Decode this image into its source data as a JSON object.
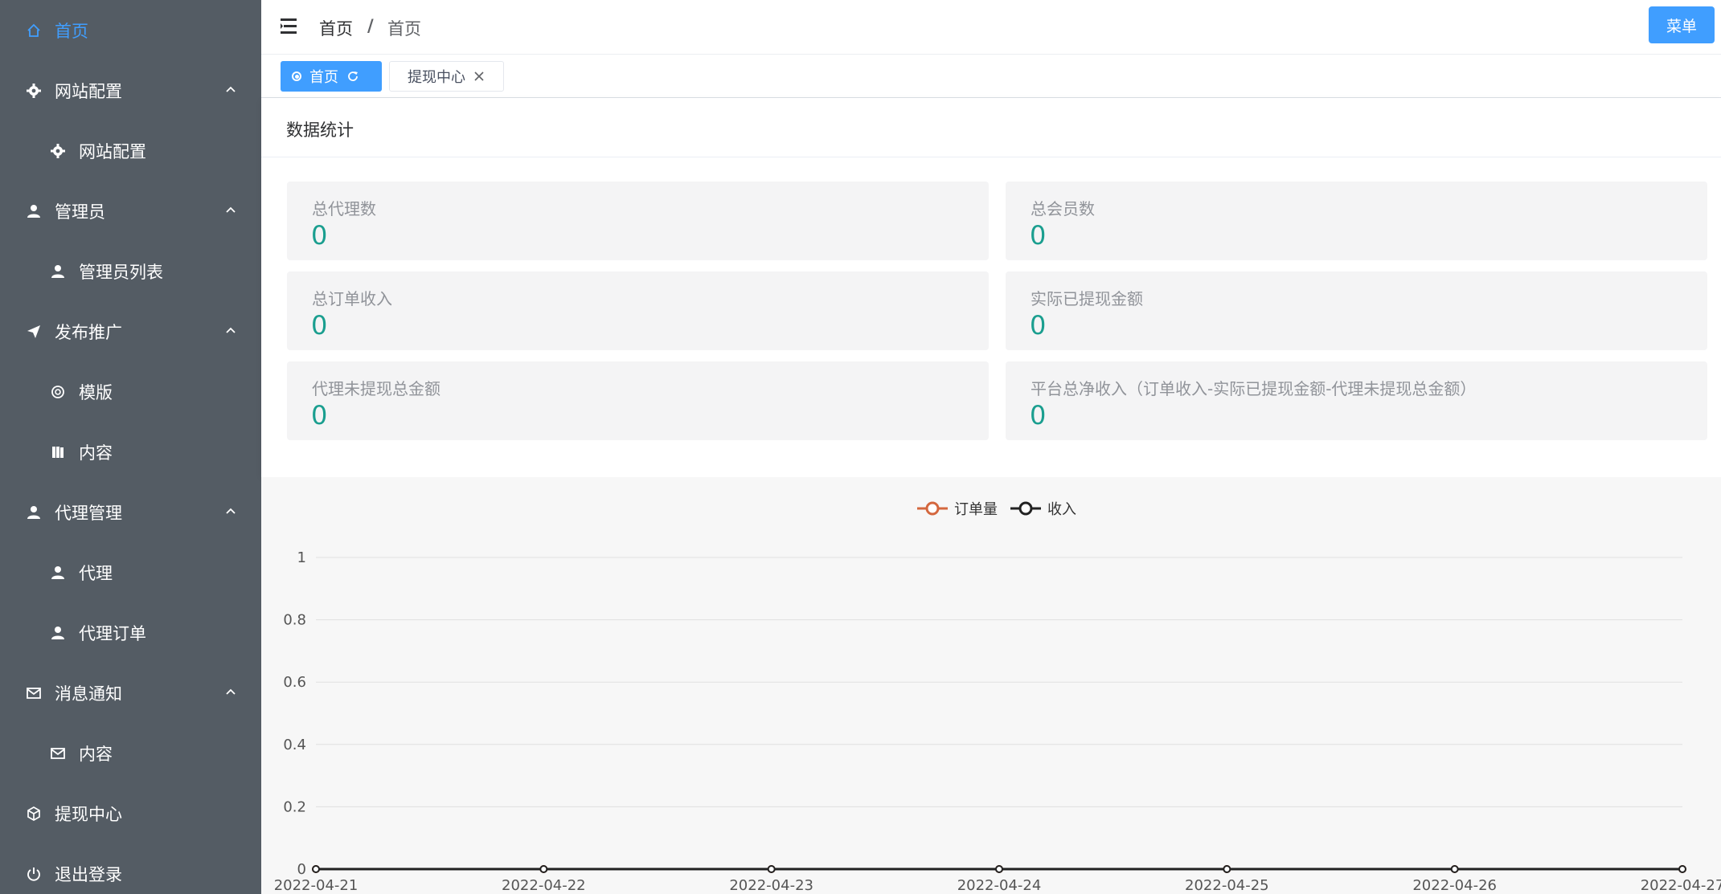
{
  "sidebar": {
    "items": [
      {
        "label": "首页",
        "icon": "home-icon",
        "level": "top",
        "active": true
      },
      {
        "label": "网站配置",
        "icon": "gear-icon",
        "level": "top",
        "expanded": true
      },
      {
        "label": "网站配置",
        "icon": "gear-icon",
        "level": "sub"
      },
      {
        "label": "管理员",
        "icon": "user-icon",
        "level": "top",
        "expanded": true
      },
      {
        "label": "管理员列表",
        "icon": "user-icon",
        "level": "sub"
      },
      {
        "label": "发布推广",
        "icon": "paper-plane-icon",
        "level": "top",
        "expanded": true
      },
      {
        "label": "模版",
        "icon": "aperture-icon",
        "level": "sub"
      },
      {
        "label": "内容",
        "icon": "book-icon",
        "level": "sub"
      },
      {
        "label": "代理管理",
        "icon": "user-icon",
        "level": "top",
        "expanded": true
      },
      {
        "label": "代理",
        "icon": "user-icon",
        "level": "sub"
      },
      {
        "label": "代理订单",
        "icon": "user-icon",
        "level": "sub"
      },
      {
        "label": "消息通知",
        "icon": "mail-icon",
        "level": "top",
        "expanded": true
      },
      {
        "label": "内容",
        "icon": "mail-icon",
        "level": "sub"
      },
      {
        "label": "提现中心",
        "icon": "box-icon",
        "level": "top"
      },
      {
        "label": "退出登录",
        "icon": "power-icon",
        "level": "top"
      }
    ]
  },
  "header": {
    "breadcrumb": [
      "首页",
      "首页"
    ],
    "breadcrumb_sep": "/",
    "menu_button": "菜单"
  },
  "tabs": [
    {
      "label": "首页",
      "active": true
    },
    {
      "label": "提现中心",
      "active": false
    }
  ],
  "stats": {
    "title": "数据统计",
    "items": [
      {
        "label": "总代理数",
        "value": "0"
      },
      {
        "label": "总会员数",
        "value": "0"
      },
      {
        "label": "总订单收入",
        "value": "0"
      },
      {
        "label": "实际已提现金额",
        "value": "0"
      },
      {
        "label": "代理未提现总金额",
        "value": "0"
      },
      {
        "label": "平台总净收入（订单收入-实际已提现金额-代理未提现总金额）",
        "value": "0"
      }
    ]
  },
  "colors": {
    "sidebar_bg": "#545c64",
    "accent": "#409eff",
    "stat_value": "#1a9e8f",
    "series_orders": "#d4673e",
    "series_income": "#222222"
  },
  "chart_data": {
    "type": "line",
    "x": [
      "2022-04-21",
      "2022-04-22",
      "2022-04-23",
      "2022-04-24",
      "2022-04-25",
      "2022-04-26",
      "2022-04-27"
    ],
    "series": [
      {
        "name": "订单量",
        "values": [
          0,
          0,
          0,
          0,
          0,
          0,
          0
        ]
      },
      {
        "name": "收入",
        "values": [
          0,
          0,
          0,
          0,
          0,
          0,
          0
        ]
      }
    ],
    "ylim": [
      0,
      1
    ],
    "yticks": [
      "0",
      "0.2",
      "0.4",
      "0.6",
      "0.8",
      "1"
    ],
    "grid": true,
    "legend": "top-center"
  }
}
